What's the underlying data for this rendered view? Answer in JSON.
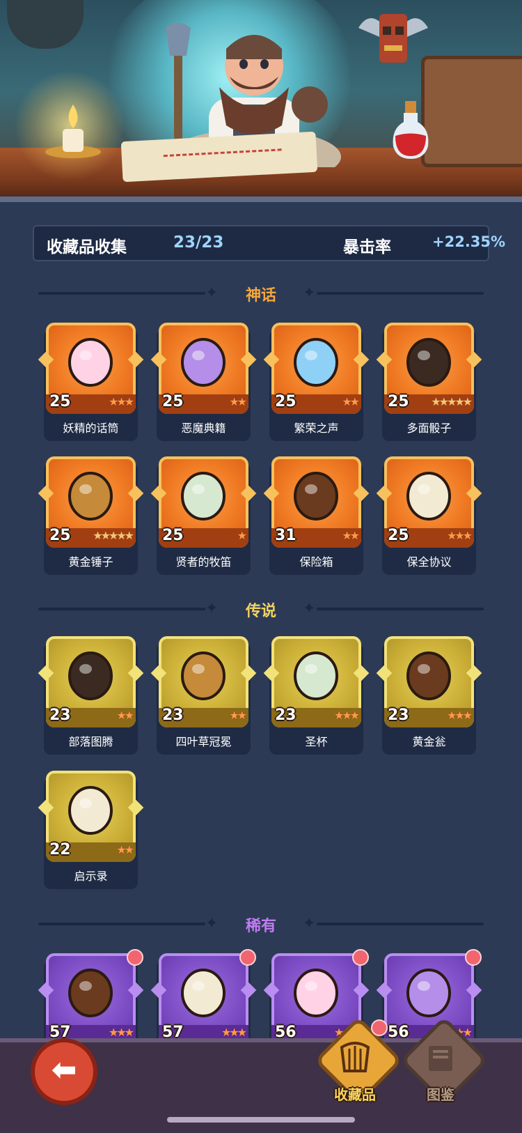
{
  "header": {
    "collection_label": "收藏品收集",
    "collection_count": "23/23",
    "crit_label": "暴击率",
    "crit_value": "+22.35%"
  },
  "sections": [
    {
      "title": "神话",
      "title_color": "#f4a73c",
      "rarity": "myth",
      "items": [
        {
          "name": "妖精的话筒",
          "level": "25",
          "stars": 3,
          "max_stars": 3,
          "icon": "fairy-microphone-icon"
        },
        {
          "name": "恶魔典籍",
          "level": "25",
          "stars": 2,
          "max_stars": 2,
          "icon": "demon-tome-icon"
        },
        {
          "name": "繁荣之声",
          "level": "25",
          "stars": 2,
          "max_stars": 2,
          "icon": "prosperity-horn-icon"
        },
        {
          "name": "多面骰子",
          "level": "25",
          "stars": 0,
          "max_stars": 5,
          "icon": "polyhedral-dice-icon"
        },
        {
          "name": "黄金锤子",
          "level": "25",
          "stars": 0,
          "max_stars": 5,
          "icon": "golden-hammer-icon"
        },
        {
          "name": "贤者的牧笛",
          "level": "25",
          "stars": 1,
          "max_stars": 1,
          "icon": "sage-flute-icon"
        },
        {
          "name": "保险箱",
          "level": "31",
          "stars": 2,
          "max_stars": 2,
          "icon": "treasure-chest-icon"
        },
        {
          "name": "保全协议",
          "level": "25",
          "stars": 3,
          "max_stars": 3,
          "icon": "security-contract-icon"
        }
      ]
    },
    {
      "title": "传说",
      "title_color": "#f0d262",
      "rarity": "leg",
      "items": [
        {
          "name": "部落图腾",
          "level": "23",
          "stars": 2,
          "max_stars": 2,
          "icon": "tribal-totem-icon"
        },
        {
          "name": "四叶草冠冕",
          "level": "23",
          "stars": 2,
          "max_stars": 2,
          "icon": "clover-crown-icon"
        },
        {
          "name": "圣杯",
          "level": "23",
          "stars": 3,
          "max_stars": 3,
          "icon": "holy-grail-icon"
        },
        {
          "name": "黄金瓮",
          "level": "23",
          "stars": 3,
          "max_stars": 3,
          "icon": "golden-urn-icon"
        },
        {
          "name": "启示录",
          "level": "22",
          "stars": 2,
          "max_stars": 2,
          "icon": "revelation-book-icon"
        }
      ]
    },
    {
      "title": "稀有",
      "title_color": "#c07cf2",
      "rarity": "rare",
      "items": [
        {
          "name": "",
          "level": "57",
          "stars": 3,
          "max_stars": 3,
          "icon": "skull-dagger-icon"
        },
        {
          "name": "",
          "level": "57",
          "stars": 3,
          "max_stars": 3,
          "icon": "stone-axe-icon"
        },
        {
          "name": "",
          "level": "56",
          "stars": 3,
          "max_stars": 3,
          "icon": "fire-feather-icon"
        },
        {
          "name": "",
          "level": "56",
          "stars": 3,
          "max_stars": 3,
          "icon": "thorn-shackles-icon"
        }
      ]
    }
  ],
  "bottom_nav": {
    "back_icon": "back-arrow-icon",
    "tabs": [
      {
        "label": "收藏品",
        "icon": "harp-icon",
        "active": true
      },
      {
        "label": "图鉴",
        "icon": "codex-book-icon",
        "active": false
      }
    ]
  }
}
